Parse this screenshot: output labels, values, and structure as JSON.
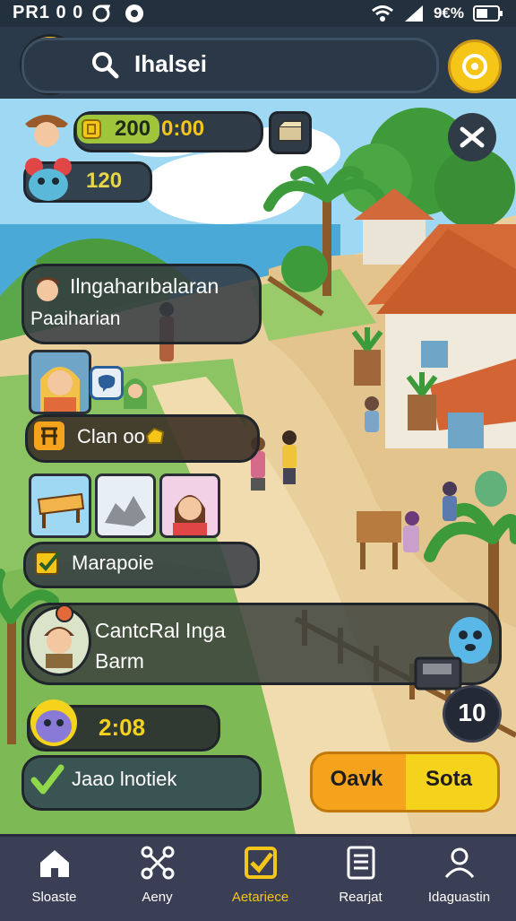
{
  "status_bar": {
    "left_text": "PR1 0 0",
    "battery_text": "9€%"
  },
  "search": {
    "text": "Ihalsei"
  },
  "hud": {
    "coins": "200",
    "timer": "0:00",
    "pet_count": "120"
  },
  "quest_card": {
    "title": "Ilngaharıbalaran",
    "subtitle": "Paaiharian"
  },
  "action_chip": {
    "label": "Clan oo"
  },
  "task_chip": {
    "label": "Marapoie"
  },
  "character_panel": {
    "line1": "CantcRal Inga",
    "line2": "Barm"
  },
  "timer_chip": {
    "value": "2:08"
  },
  "check_chip": {
    "label": "Jaao lnotiek"
  },
  "counter_badge": {
    "value": "10"
  },
  "buttons": {
    "left": "Oavk",
    "right": "Sota"
  },
  "nav": [
    {
      "label": "Sloaste",
      "icon": "home-icon"
    },
    {
      "label": "Aeny",
      "icon": "network-icon"
    },
    {
      "label": "Aetariece",
      "icon": "checkbox-icon",
      "active": true
    },
    {
      "label": "Rearjat",
      "icon": "document-icon"
    },
    {
      "label": "Idaguastin",
      "icon": "person-icon"
    }
  ],
  "colors": {
    "accent": "#f5c518",
    "topbar": "#2b3a4b",
    "panel": "#343a42",
    "button_orange": "#f5a21c",
    "button_yellow": "#f5d21c",
    "nav_bg": "#3a3f55"
  }
}
